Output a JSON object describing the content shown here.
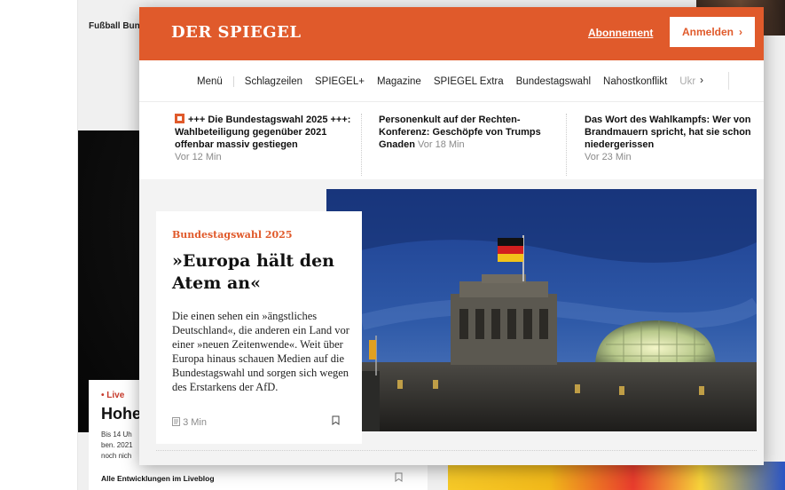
{
  "background_page": {
    "section_label": "Fußball Bun",
    "live_badge": "• Live",
    "headline_fragment": "Hohe",
    "teaser_lines": [
      "Bis 14 Uh",
      "ben. 2021",
      "noch nich"
    ],
    "liveblog_link": "Alle Entwicklungen im Liveblog",
    "bookmark_icon": "bookmark-icon"
  },
  "popup": {
    "brand": {
      "logo_text": "DER SPIEGEL",
      "color": "#e05a2b"
    },
    "header": {
      "subscription_link": "Abonnement",
      "login_button": "Anmelden",
      "login_arrow": "›"
    },
    "nav": {
      "items": [
        "Menü",
        "Schlagzeilen",
        "SPIEGEL+",
        "Magazine",
        "SPIEGEL Extra",
        "Bundestagswahl",
        "Nahostkonflikt",
        "Ukr"
      ],
      "more": "›"
    },
    "ticker": [
      {
        "prefix": "+++ Die Bundestagswahl 2025 +++:",
        "title": "Wahlbeteiligung gegenüber 2021 offenbar massiv gestiegen",
        "time": "Vor 12 Min",
        "icon": "breaking-news-icon"
      },
      {
        "prefix": "Personenkult auf der Rechten-Konferenz:",
        "title": "Geschöpfe von Trumps Gnaden",
        "time": "Vor 18 Min"
      },
      {
        "prefix": "Das Wort des Wahlkampfs:",
        "title": "Wer von Brandmauern spricht, hat sie schon niedergerissen",
        "time": "Vor 23 Min"
      }
    ],
    "article": {
      "kicker": "Bundestagswahl 2025",
      "headline": "»Europa hält den Atem an«",
      "teaser": "Die einen sehen ein »ängstliches Deutschland«, die anderen ein Land vor einer »neuen Zeitenwende«. Weit über Europa hinaus schauen Medien auf die Bundestagswahl und sorgen sich wegen des Erstarkens der AfD.",
      "read_time": "3 Min",
      "read_icon": "article-icon",
      "bookmark_icon": "bookmark-icon",
      "image_subject": "reichstag-building-at-dusk"
    }
  }
}
